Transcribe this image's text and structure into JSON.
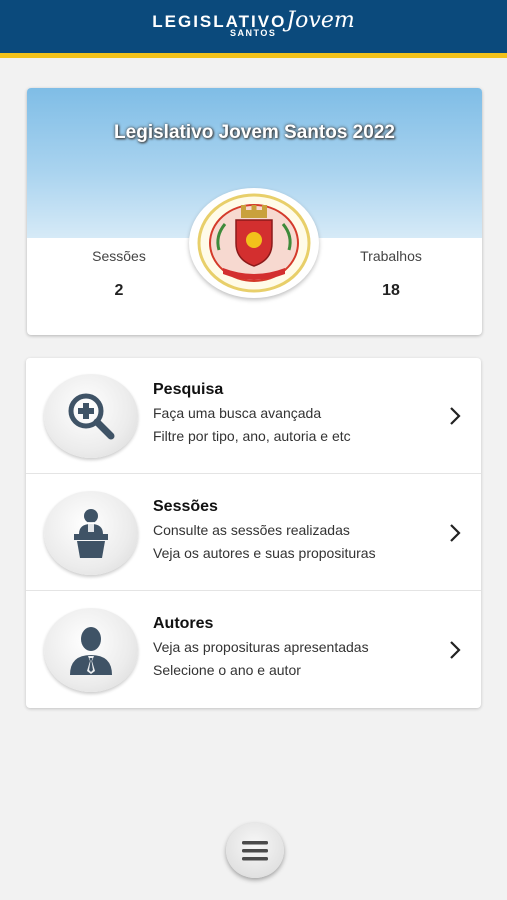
{
  "header": {
    "brand_main": "LEGISLATIVO",
    "brand_script": "Jovem",
    "brand_sub": "SANTOS"
  },
  "summary": {
    "title": "Legislativo Jovem Santos 2022",
    "stats": [
      {
        "label": "Sessões",
        "value": "2"
      },
      {
        "label": "Trabalhos",
        "value": "18"
      }
    ]
  },
  "menu": {
    "items": [
      {
        "title": "Pesquisa",
        "line1": "Faça uma busca avançada",
        "line2": "Filtre por tipo, ano, autoria e etc",
        "icon": "search-plus-icon"
      },
      {
        "title": "Sessões",
        "line1": "Consulte as sessões realizadas",
        "line2": "Veja os autores e suas proposituras",
        "icon": "podium-speaker-icon"
      },
      {
        "title": "Autores",
        "line1": "Veja as proposituras apresentadas",
        "line2": "Selecione o ano e autor",
        "icon": "person-icon"
      }
    ]
  },
  "fab": {
    "icon": "hamburger-menu-icon"
  },
  "colors": {
    "header_bg": "#0b4a7c",
    "header_accent": "#f2c21b",
    "banner_light_blue": "#a9d3ef",
    "icon_slate": "#3f5366"
  }
}
